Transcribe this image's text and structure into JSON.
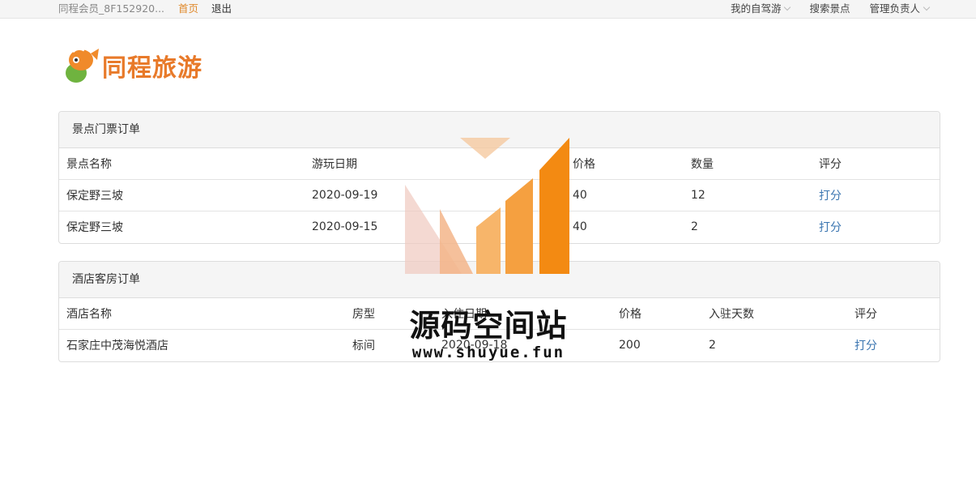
{
  "topbar": {
    "member": "同程会员_8F152920...",
    "home": "首页",
    "logout": "退出",
    "nav": [
      "我的自驾游",
      "搜索景点",
      "管理负责人"
    ]
  },
  "logo": {
    "text": "同程旅游"
  },
  "ticket_orders": {
    "title": "景点门票订单",
    "headers": [
      "景点名称",
      "游玩日期",
      "",
      "价格",
      "数量",
      "评分"
    ],
    "rows": [
      [
        "保定野三坡",
        "2020-09-19",
        "",
        "40",
        "12",
        "打分"
      ],
      [
        "保定野三坡",
        "2020-09-15",
        "",
        "40",
        "2",
        "打分"
      ]
    ]
  },
  "hotel_orders": {
    "title": "酒店客房订单",
    "headers": [
      "酒店名称",
      "房型",
      "入住日期",
      "价格",
      "入驻天数",
      "评分"
    ],
    "rows": [
      [
        "石家庄中茂海悦酒店",
        "标间",
        "2020-09-18",
        "200",
        "2",
        "打分"
      ]
    ]
  },
  "watermark": {
    "name": "源码空间站",
    "url": "www.shuyue.fun"
  },
  "colors": {
    "accent": "#e08a2d",
    "link": "#3a75b0",
    "panel_bg": "#f5f5f5",
    "border": "#dddddd"
  }
}
